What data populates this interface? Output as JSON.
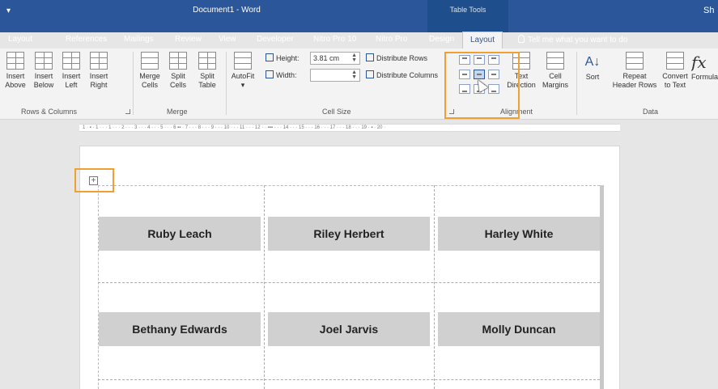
{
  "window": {
    "quick_access": "▾",
    "title": "Document1 - Word",
    "context_tab_group": "Table Tools",
    "user": "Sh"
  },
  "tabs": [
    "Layout",
    "References",
    "Mailings",
    "Review",
    "View",
    "Developer",
    "Nitro Pro 10",
    "Nitro Pro",
    "Design",
    "Layout"
  ],
  "tell_me": "Tell me what you want to do",
  "ribbon": {
    "rows_columns": {
      "insert_above": [
        "Insert",
        "Above"
      ],
      "insert_below": [
        "Insert",
        "Below"
      ],
      "insert_left": [
        "Insert",
        "Left"
      ],
      "insert_right": [
        "Insert",
        "Right"
      ],
      "group": "Rows & Columns"
    },
    "merge": {
      "merge_cells": [
        "Merge",
        "Cells"
      ],
      "split_cells": [
        "Split",
        "Cells"
      ],
      "split_table": [
        "Split",
        "Table"
      ],
      "group": "Merge"
    },
    "cell_size": {
      "autofit": "AutoFit",
      "height_label": "Height:",
      "height_value": "3.81 cm",
      "width_label": "Width:",
      "width_value": "",
      "distribute_rows": "Distribute Rows",
      "distribute_columns": "Distribute Columns",
      "group": "Cell Size"
    },
    "alignment": {
      "text_direction": [
        "Text",
        "Direction"
      ],
      "cell_margins": [
        "Cell",
        "Margins"
      ],
      "group": "Alignment"
    },
    "data": {
      "sort": "Sort",
      "repeat_header_rows": [
        "Repeat",
        "Header Rows"
      ],
      "convert_to_text": [
        "Convert",
        "to Text"
      ],
      "formula": "Formula",
      "formula_symbol": "fx",
      "group": "Data"
    }
  },
  "ruler_text": "1 · ▪ · 1 · · · 1 · · · 2 · · · 3 · · · 4 · · · 5 · · · 6 ▪▪ · 7 · · · 8 · · · 9 · · · 10 · · · 11 · · · 12 · · ▪▪▪ · · · 14 · · · 15 · · · 16 · · · 17 · · · 18 · · · 19 · ▪ · 20 ·",
  "table_move_handle": "+",
  "labels": [
    [
      "Ruby Leach",
      "Riley Herbert",
      "Harley White"
    ],
    [
      "Bethany Edwards",
      "Joel Jarvis",
      "Molly Duncan"
    ]
  ],
  "colors": {
    "title_bar": "#2b579a",
    "ribbon": "#f3f3f3",
    "highlight": "#f0a030",
    "label_fill": "#d0d0d0"
  }
}
